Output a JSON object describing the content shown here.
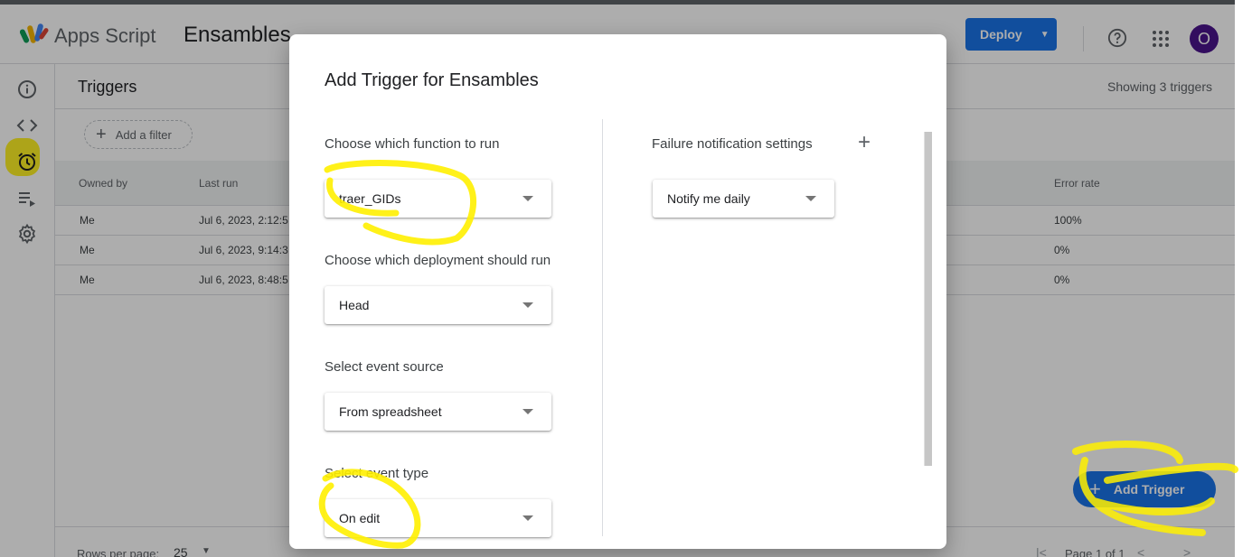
{
  "header": {
    "app_name": "Apps Script",
    "project_name": "Ensambles",
    "deploy_label": "Deploy",
    "avatar_letter": "O"
  },
  "rail": {
    "items": [
      "info-icon",
      "code-icon",
      "alarm-icon",
      "executions-icon",
      "settings-icon"
    ]
  },
  "triggers_page": {
    "title": "Triggers",
    "count_text": "Showing 3 triggers",
    "filter_label": "Add a filter",
    "columns": {
      "owned_by": "Owned by",
      "last_run": "Last run",
      "error_rate": "Error rate"
    },
    "rows": [
      {
        "owner": "Me",
        "last_run": "Jul 6, 2023, 2:12:5",
        "error_rate": "100%"
      },
      {
        "owner": "Me",
        "last_run": "Jul 6, 2023, 9:14:3",
        "error_rate": "0%"
      },
      {
        "owner": "Me",
        "last_run": "Jul 6, 2023, 8:48:5",
        "error_rate": "0%"
      }
    ],
    "rows_per_page_label": "Rows per page:",
    "rows_per_page_value": "25",
    "page_label": "Page 1 of 1",
    "add_trigger_label": "Add Trigger"
  },
  "dialog": {
    "title": "Add Trigger for Ensambles",
    "function_label": "Choose which function to run",
    "function_value": "traer_GIDs",
    "deployment_label": "Choose which deployment should run",
    "deployment_value": "Head",
    "event_source_label": "Select event source",
    "event_source_value": "From spreadsheet",
    "event_type_label": "Select event type",
    "event_type_value": "On edit",
    "failure_label": "Failure notification settings",
    "failure_value": "Notify me daily"
  },
  "colors": {
    "accent": "#1a73e8",
    "avatar": "#4a148c",
    "highlighter": "#fff000"
  }
}
